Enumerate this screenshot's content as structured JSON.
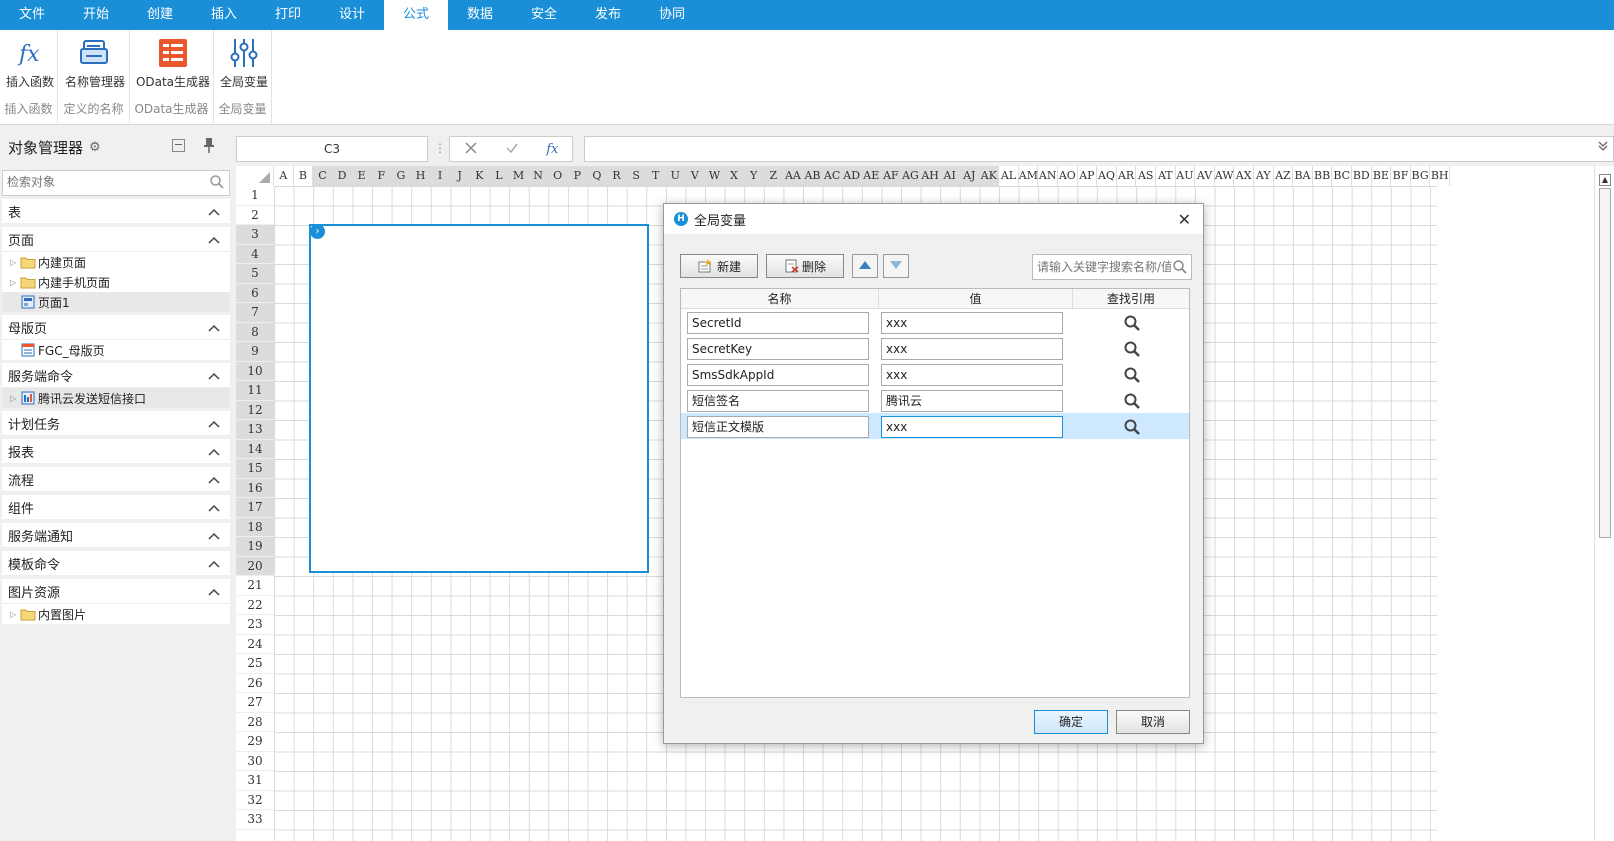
{
  "menubar": {
    "tabs": [
      "文件",
      "开始",
      "创建",
      "插入",
      "打印",
      "设计",
      "公式",
      "数据",
      "安全",
      "发布",
      "协同"
    ],
    "active_index": 6
  },
  "ribbon": {
    "insert_function": {
      "label": "插入函数",
      "group": "插入函数"
    },
    "name_manager": {
      "label": "名称管理器",
      "group": "定义的名称"
    },
    "odata": {
      "label": "OData生成器",
      "group": "OData生成器"
    },
    "global_vars": {
      "label": "全局变量",
      "group": "全局变量"
    }
  },
  "left_panel": {
    "title": "对象管理器",
    "search_placeholder": "检索对象",
    "sections": {
      "table": {
        "title": "表"
      },
      "page": {
        "title": "页面",
        "items": [
          "内建页面",
          "内建手机页面",
          "页面1"
        ]
      },
      "master": {
        "title": "母版页",
        "items": [
          "FGC_母版页"
        ]
      },
      "server_cmd": {
        "title": "服务端命令",
        "items": [
          "腾讯云发送短信接口"
        ]
      },
      "scheduled": {
        "title": "计划任务"
      },
      "report": {
        "title": "报表"
      },
      "flow": {
        "title": "流程"
      },
      "component": {
        "title": "组件"
      },
      "server_notify": {
        "title": "服务端通知"
      },
      "template_cmd": {
        "title": "模板命令"
      },
      "images": {
        "title": "图片资源",
        "items": [
          "内置图片"
        ]
      }
    }
  },
  "formula_bar": {
    "cell_ref": "C3",
    "dots": "⋮",
    "fx": "fx",
    "formula": ""
  },
  "sheet": {
    "columns": [
      "A",
      "B",
      "C",
      "D",
      "E",
      "F",
      "G",
      "H",
      "I",
      "J",
      "K",
      "L",
      "M",
      "N",
      "O",
      "P",
      "Q",
      "R",
      "S",
      "T",
      "U",
      "V",
      "W",
      "X",
      "Y",
      "Z",
      "AA",
      "AB",
      "AC",
      "AD",
      "AE",
      "AF",
      "AG",
      "AH",
      "AI",
      "AJ",
      "AK",
      "AL",
      "AM",
      "AN",
      "AO",
      "AP",
      "AQ",
      "AR",
      "AS",
      "AT",
      "AU",
      "AV",
      "AW",
      "AX",
      "AY",
      "AZ",
      "BA",
      "BB",
      "BC",
      "BD",
      "BE",
      "BF",
      "BG",
      "BH"
    ],
    "selected_columns": [
      "C",
      "D",
      "E",
      "F",
      "G",
      "H",
      "I",
      "J",
      "K",
      "L",
      "M",
      "N",
      "O",
      "P",
      "Q",
      "R",
      "S",
      "T",
      "U",
      "V",
      "W",
      "X",
      "Y",
      "Z",
      "AA",
      "AB",
      "AC",
      "AD",
      "AE",
      "AF",
      "AG",
      "AH",
      "AI",
      "AJ",
      "AK"
    ],
    "rows": [
      "1",
      "2",
      "3",
      "4",
      "5",
      "6",
      "7",
      "8",
      "9",
      "10",
      "11",
      "12",
      "13",
      "14",
      "15",
      "16",
      "17",
      "18",
      "19",
      "20",
      "21",
      "22",
      "23",
      "24",
      "25",
      "26",
      "27",
      "28",
      "29",
      "30",
      "31",
      "32",
      "33"
    ],
    "selected_rows_from": 3,
    "selected_rows_to": 20
  },
  "dialog": {
    "title": "全局变量",
    "new_label": "新建",
    "delete_label": "删除",
    "search_placeholder": "请输入关键字搜索名称/值",
    "headers": {
      "name": "名称",
      "value": "值",
      "find": "查找引用"
    },
    "rows": [
      {
        "name": "SecretId",
        "value": "xxx"
      },
      {
        "name": "SecretKey",
        "value": "xxx"
      },
      {
        "name": "SmsSdkAppId",
        "value": "xxx"
      },
      {
        "name": "短信签名",
        "value": "腾讯云"
      },
      {
        "name": "短信正文模版",
        "value": "xxx"
      }
    ],
    "active_row": 4,
    "ok_label": "确定",
    "cancel_label": "取消"
  },
  "colors": {
    "accent": "#1a8fd8",
    "odata_icon": "#e8582c"
  }
}
